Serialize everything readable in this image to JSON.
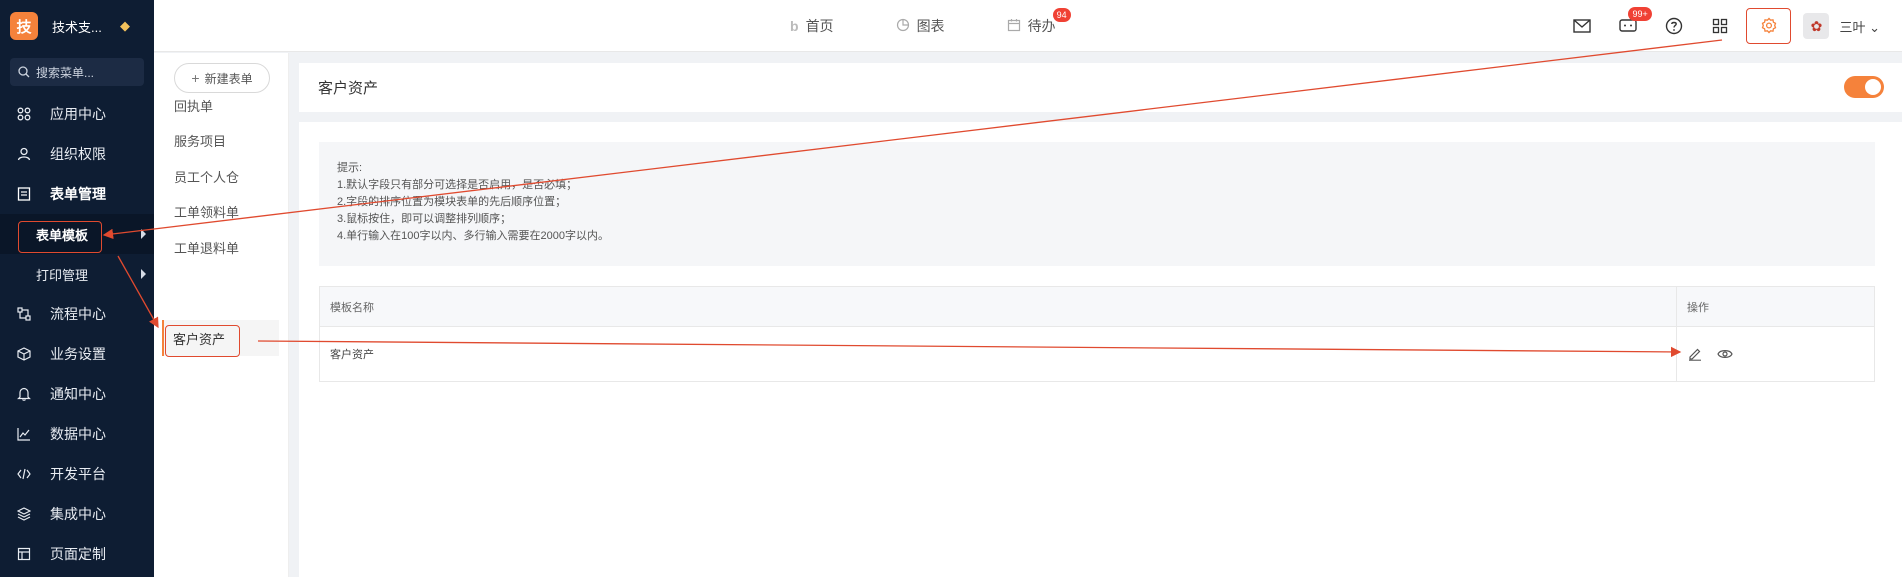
{
  "brand": {
    "logo_char": "技",
    "name": "技术支..."
  },
  "sidebar": {
    "search_placeholder": "搜索菜单...",
    "items": [
      {
        "label": "应用中心"
      },
      {
        "label": "组织权限"
      },
      {
        "label": "表单管理"
      },
      {
        "label": "表单模板"
      },
      {
        "label": "打印管理"
      },
      {
        "label": "流程中心"
      },
      {
        "label": "业务设置"
      },
      {
        "label": "通知中心"
      },
      {
        "label": "数据中心"
      },
      {
        "label": "开发平台"
      },
      {
        "label": "集成中心"
      },
      {
        "label": "页面定制"
      }
    ]
  },
  "topnav": {
    "home": "首页",
    "charts": "图表",
    "todo": "待办",
    "todo_badge": "94",
    "chat_badge": "99+",
    "user_name": "三叶"
  },
  "forms": {
    "new_button": "新建表单",
    "items": [
      "回执单",
      "服务项目",
      "员工个人仓",
      "工单领料单",
      "工单退料单",
      "客户资产"
    ]
  },
  "main": {
    "title": "客户资产",
    "toggle_on": true,
    "tips": [
      "提示:",
      "1.默认字段只有部分可选择是否启用，是否必填；",
      "2.字段的排序位置为模块表单的先后顺序位置；",
      "3.鼠标按住，即可以调整排列顺序；",
      "4.单行输入在100字以内、多行输入需要在2000字以内。"
    ],
    "table": {
      "col_name": "模板名称",
      "col_action": "操作",
      "rows": [
        {
          "name": "客户资产"
        }
      ]
    }
  },
  "colors": {
    "accent": "#f5823b",
    "sidebar_bg": "#0e1d33",
    "annotation": "#e04a2f"
  }
}
